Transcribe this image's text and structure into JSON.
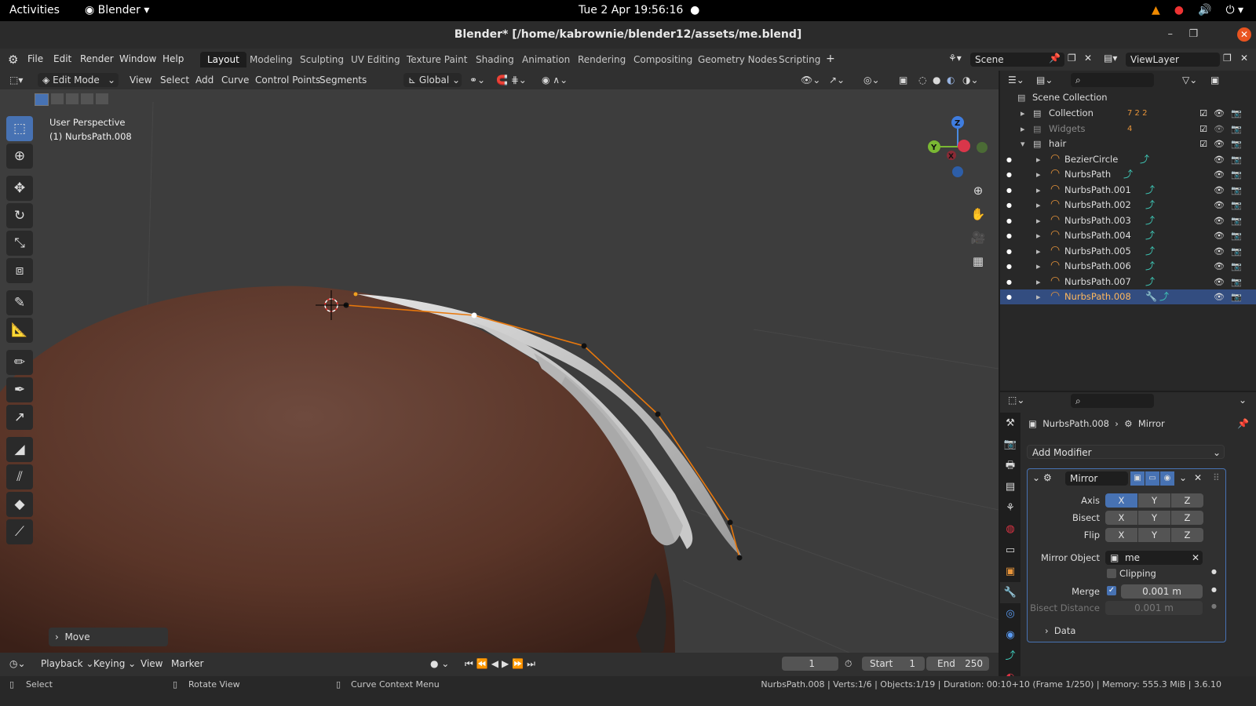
{
  "system": {
    "activities": "Activities",
    "app_name": "Blender",
    "clock": "Tue 2 Apr  19:56:16"
  },
  "window": {
    "title": "Blender* [/home/kabrownie/blender12/assets/me.blend]"
  },
  "menu": [
    "File",
    "Edit",
    "Render",
    "Window",
    "Help"
  ],
  "workspaces": [
    {
      "label": "Layout",
      "active": true
    },
    {
      "label": "Modeling"
    },
    {
      "label": "Sculpting"
    },
    {
      "label": "UV Editing"
    },
    {
      "label": "Texture Paint"
    },
    {
      "label": "Shading"
    },
    {
      "label": "Animation"
    },
    {
      "label": "Rendering"
    },
    {
      "label": "Compositing"
    },
    {
      "label": "Geometry Nodes"
    },
    {
      "label": "Scripting"
    }
  ],
  "add_workspace": "+",
  "scene": "Scene",
  "view_layer": "ViewLayer",
  "viewport": {
    "mode": "Edit Mode",
    "menus": [
      "View",
      "Select",
      "Add",
      "Curve",
      "Control Points",
      "Segments"
    ],
    "orientation": "Global",
    "overlay_line1": "User Perspective",
    "overlay_line2": "(1) NurbsPath.008",
    "gizmo": {
      "x": "X",
      "y": "Y",
      "z": "Z"
    },
    "last_op": "Move"
  },
  "outliner": {
    "root": "Scene Collection",
    "rows": [
      {
        "name": "Collection",
        "type": "collection",
        "indent": 1,
        "extra": "7 2 2"
      },
      {
        "name": "Widgets",
        "type": "collection",
        "indent": 1,
        "dim": true,
        "extra": "4"
      },
      {
        "name": "hair",
        "type": "collection",
        "indent": 1,
        "open": true
      },
      {
        "name": "BezierCircle",
        "type": "curve",
        "indent": 2
      },
      {
        "name": "NurbsPath",
        "type": "curve",
        "indent": 2
      },
      {
        "name": "NurbsPath.001",
        "type": "curve",
        "indent": 2
      },
      {
        "name": "NurbsPath.002",
        "type": "curve",
        "indent": 2
      },
      {
        "name": "NurbsPath.003",
        "type": "curve",
        "indent": 2
      },
      {
        "name": "NurbsPath.004",
        "type": "curve",
        "indent": 2
      },
      {
        "name": "NurbsPath.005",
        "type": "curve",
        "indent": 2
      },
      {
        "name": "NurbsPath.006",
        "type": "curve",
        "indent": 2
      },
      {
        "name": "NurbsPath.007",
        "type": "curve",
        "indent": 2
      },
      {
        "name": "NurbsPath.008",
        "type": "curve",
        "indent": 2,
        "selected": true
      }
    ]
  },
  "properties": {
    "breadcrumb_object": "NurbsPath.008",
    "breadcrumb_modifier": "Mirror",
    "add_modifier": "Add Modifier",
    "modifier_name": "Mirror",
    "axis_label": "Axis",
    "bisect_label": "Bisect",
    "flip_label": "Flip",
    "axes": [
      "X",
      "Y",
      "Z"
    ],
    "axis_enabled": [
      true,
      false,
      false
    ],
    "mirror_object_label": "Mirror Object",
    "mirror_object": "me",
    "clipping_label": "Clipping",
    "clipping": false,
    "merge_label": "Merge",
    "merge_enabled": true,
    "merge_value": "0.001 m",
    "bisect_distance_label": "Bisect Distance",
    "bisect_distance": "0.001 m",
    "data_label": "Data"
  },
  "timeline": {
    "menus": [
      "Playback",
      "Keying",
      "View",
      "Marker"
    ],
    "current_frame": "1",
    "start_label": "Start",
    "start": "1",
    "end_label": "End",
    "end": "250"
  },
  "status": {
    "select": "Select",
    "rotate": "Rotate View",
    "context": "Curve Context Menu",
    "info": "NurbsPath.008 | Verts:1/6 | Objects:1/19 | Duration: 00:10+10 (Frame 1/250) | Memory: 555.3 MiB | 3.6.10"
  }
}
